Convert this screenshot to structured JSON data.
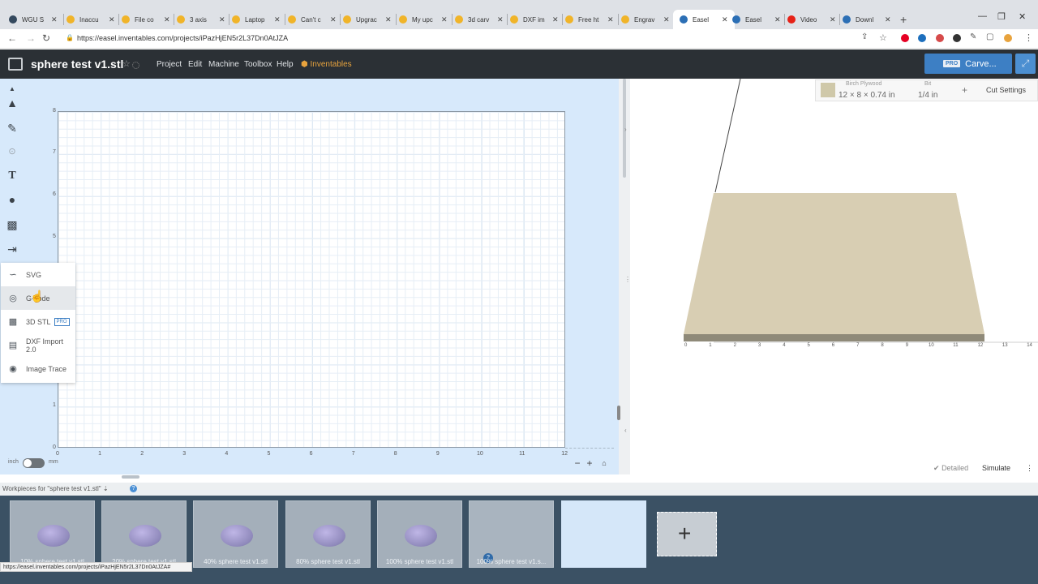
{
  "browser": {
    "tabs": [
      {
        "label": "WGU S",
        "color": "#34495e"
      },
      {
        "label": "Inaccu",
        "color": "#f0b429"
      },
      {
        "label": "File co",
        "color": "#f0b429"
      },
      {
        "label": "3 axis",
        "color": "#f0b429"
      },
      {
        "label": "Laptop",
        "color": "#f0b429"
      },
      {
        "label": "Can't c",
        "color": "#f0b429"
      },
      {
        "label": "Upgrac",
        "color": "#f0b429"
      },
      {
        "label": "My upc",
        "color": "#f0b429"
      },
      {
        "label": "3d carv",
        "color": "#f0b429"
      },
      {
        "label": "DXF im",
        "color": "#f0b429"
      },
      {
        "label": "Free ht",
        "color": "#f0b429"
      },
      {
        "label": "Engrav",
        "color": "#f0b429"
      },
      {
        "label": "Easel",
        "color": "#2c6fb5"
      },
      {
        "label": "Easel",
        "color": "#2c6fb5"
      },
      {
        "label": "Video",
        "color": "#e62117"
      },
      {
        "label": "Downl",
        "color": "#2c6fb5"
      }
    ],
    "url": "https://easel.inventables.com/projects/iPazHjEN5r2L37Dn0AtJZA",
    "status_url": "https://easel.inventables.com/projects/iPazHjEN5r2L37Dn0AtJZA#"
  },
  "header": {
    "title": "sphere test v1.stl",
    "menu": [
      "Project",
      "Edit",
      "Machine",
      "Toolbox",
      "Help"
    ],
    "inventables": "Inventables",
    "pro": "PRO",
    "carve": "Carve..."
  },
  "canvas": {
    "x_ticks": [
      "0",
      "1",
      "2",
      "3",
      "4",
      "5",
      "6",
      "7",
      "8",
      "9",
      "10",
      "11",
      "12"
    ],
    "y_ticks": [
      "8",
      "7",
      "6",
      "5",
      "1",
      "0"
    ],
    "unit_inch": "inch",
    "unit_mm": "mm"
  },
  "import_menu": [
    {
      "label": "SVG",
      "icon": "svg-icon"
    },
    {
      "label": "G-code",
      "icon": "gcode-icon"
    },
    {
      "label": "3D STL",
      "icon": "cube-icon",
      "pro": "PRO"
    },
    {
      "label": "DXF Import 2.0",
      "icon": "dxf-icon"
    },
    {
      "label": "Image Trace",
      "icon": "camera-icon"
    }
  ],
  "preview": {
    "material_name": "Birch Plywood",
    "material_dims": "12 × 8 × 0.74 in",
    "bit_label": "Bit",
    "bit_value": "1/4 in",
    "cut_settings": "Cut Settings",
    "detailed": "Detailed",
    "simulate": "Simulate",
    "x_ticks": [
      "0",
      "1",
      "2",
      "3",
      "4",
      "5",
      "6",
      "7",
      "8",
      "9",
      "10",
      "11",
      "12",
      "13",
      "14"
    ]
  },
  "workpieces": {
    "title": "Workpieces for \"sphere test v1.stl\"",
    "items": [
      {
        "caption": "10% sphere test v1.stl"
      },
      {
        "caption": "20% sphere test v1.stl"
      },
      {
        "caption": "40% sphere test v1.stl"
      },
      {
        "caption": "80% sphere test v1.stl"
      },
      {
        "caption": "100% sphere test v1.stl"
      },
      {
        "caption": "100% sphere test v1.s..."
      },
      {
        "caption": ""
      }
    ]
  }
}
